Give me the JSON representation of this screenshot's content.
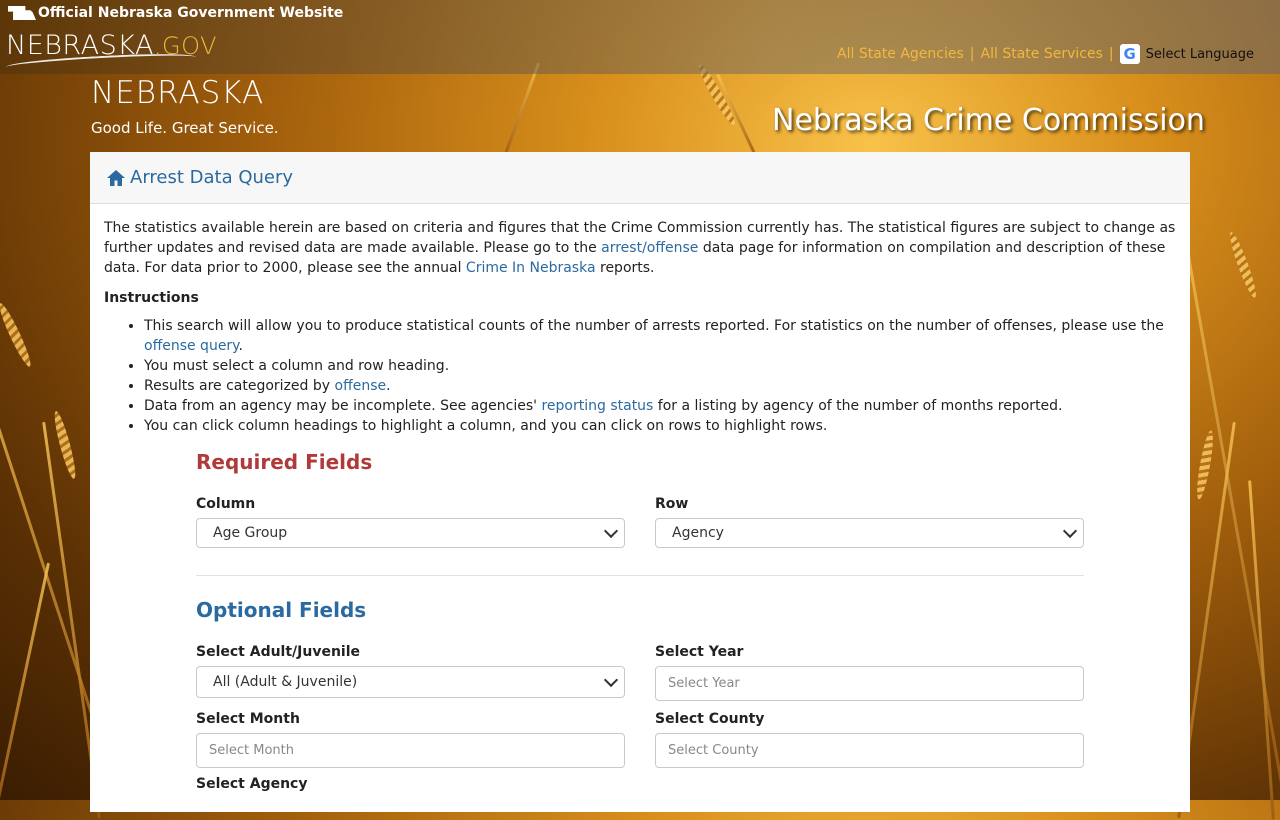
{
  "gov_bar": {
    "official": "Official Nebraska Government Website",
    "logo_main": "NEBRASKA",
    "logo_suffix": ".GOV",
    "links": [
      "All State Agencies",
      "All State Services"
    ],
    "separator": "|",
    "language_label": "Select Language",
    "google_glyph": "G"
  },
  "site_header": {
    "logo_word": "NEBRASKA",
    "tagline": "Good Life. Great Service.",
    "title": "Nebraska Crime Commission"
  },
  "card": {
    "header_title": "Arrest Data Query",
    "header_icon": "home-icon",
    "intro": {
      "part1": "The statistics available herein are based on criteria and figures that the Crime Commission currently has. The statistical figures are subject to change as further updates and revised data are made available. Please go to the ",
      "link1": "arrest/offense",
      "part2": " data page for information on compilation and description of these data. For data prior to 2000, please see the annual ",
      "link2": "Crime In Nebraska",
      "part3": " reports."
    },
    "instructions_heading": "Instructions",
    "instructions": {
      "i1_text": "This search will allow you to produce statistical counts of the number of arrests reported. For statistics on the number of offenses, please use the ",
      "i1_link": "offense query",
      "i1_end": ".",
      "i2_text": "You must select a column and row heading.",
      "i3_text": "Results are categorized by ",
      "i3_link": "offense",
      "i3_end": ".",
      "i4_text": "Data from an agency may be incomplete. See agencies' ",
      "i4_link": "reporting status",
      "i4_end": " for a listing by agency of the number of months reported.",
      "i5_text": "You can click column headings to highlight a column, and you can click on rows to highlight rows."
    }
  },
  "form": {
    "required_title": "Required Fields",
    "column_label": "Column",
    "column_value": "Age Group",
    "row_label": "Row",
    "row_value": "Agency",
    "optional_title": "Optional Fields",
    "adult_label": "Select Adult/Juvenile",
    "adult_value": "All (Adult & Juvenile)",
    "year_label": "Select Year",
    "year_placeholder": "Select Year",
    "month_label": "Select Month",
    "month_placeholder": "Select Month",
    "county_label": "Select County",
    "county_placeholder": "Select County",
    "agency_label": "Select Agency"
  },
  "colors": {
    "link": "#2a6aa0",
    "required": "#b03a3a",
    "gold": "#f0b93d"
  }
}
